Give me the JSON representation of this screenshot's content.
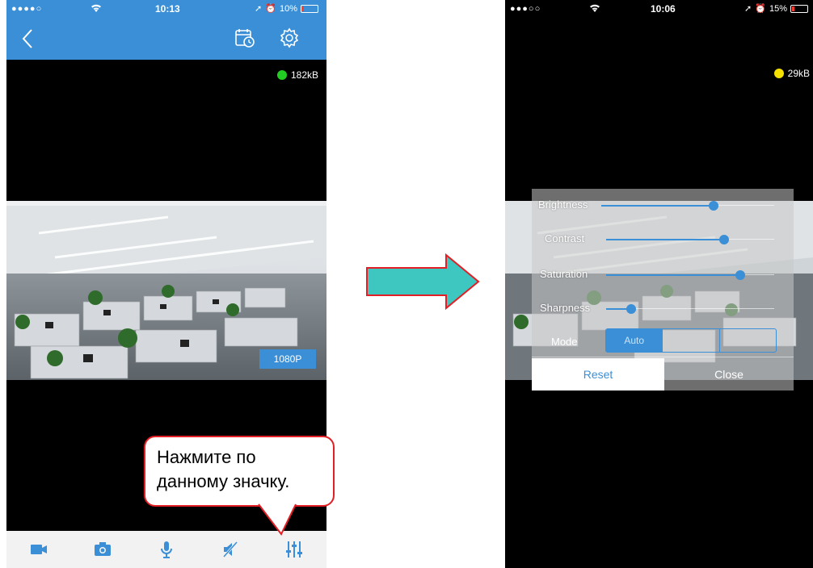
{
  "left_phone": {
    "status": {
      "signal": "●●●●○",
      "time": "10:13",
      "battery": "10%",
      "battery_fill": 0.1
    },
    "data_rate": "182kB",
    "data_rate_color": "#22cc22",
    "resolution_label": "1080P",
    "callout": {
      "line1": "Нажмите по",
      "line2": "данному значку."
    },
    "toolbar": {
      "icons": [
        "video-camera-icon",
        "camera-icon",
        "microphone-icon",
        "speaker-muted-icon",
        "sliders-icon"
      ]
    }
  },
  "right_phone": {
    "status": {
      "signal": "●●●○○",
      "time": "10:06",
      "battery": "15%",
      "battery_fill": 0.15
    },
    "data_rate": "29kB",
    "data_rate_color": "#f5e000",
    "panel": {
      "brightness_label": "Brightness",
      "brightness_value": 0.65,
      "contrast_label": "Contrast",
      "contrast_value": 0.7,
      "saturation_label": "Saturation",
      "saturation_value": 0.8,
      "sharpness_label": "Sharpness",
      "sharpness_value": 0.15,
      "mode_label": "Mode",
      "mode_options": [
        "Auto",
        "",
        ""
      ],
      "reset_label": "Reset",
      "close_label": "Close"
    }
  },
  "colors": {
    "accent": "#3a8fd6",
    "callout_border": "#e31e24",
    "arrow_fill": "#3ec6c0"
  }
}
